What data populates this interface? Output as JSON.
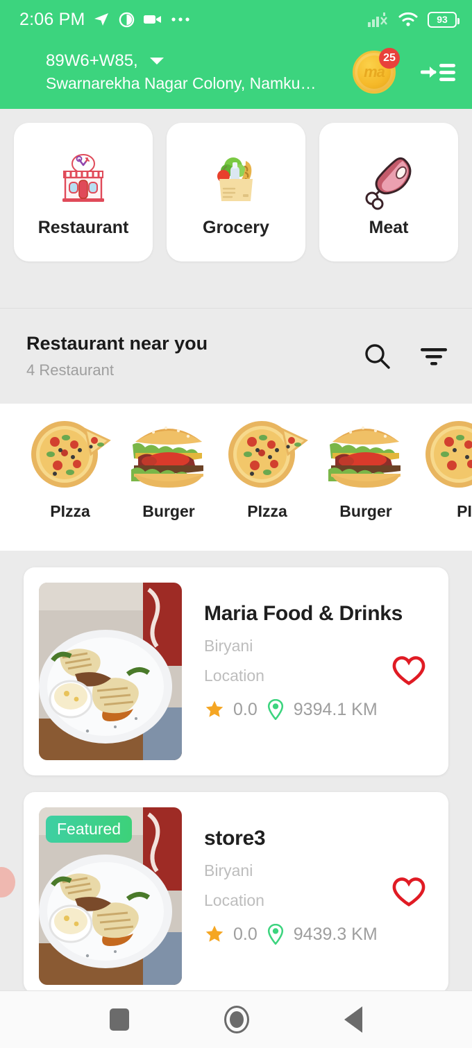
{
  "status_bar": {
    "time": "2:06 PM",
    "battery_percent": "93",
    "icons": [
      "send-icon",
      "contrast-circle-icon",
      "video-camera-icon",
      "more-dots-icon",
      "cellular-signal-icon",
      "wifi-icon",
      "battery-icon"
    ]
  },
  "header": {
    "address_code": "89W6+W85,",
    "address_detail": "Swarnarekha Nagar Colony, Namkum, ...",
    "dropdown_icon": "chevron-down-icon",
    "coin_label": "ma",
    "coin_badge_count": "25",
    "menu_icon": "drawer-menu-icon",
    "background_color": "#3cd47e"
  },
  "categories": [
    {
      "label": "Restaurant",
      "icon": "restaurant-building-icon"
    },
    {
      "label": "Grocery",
      "icon": "grocery-bag-icon"
    },
    {
      "label": "Meat",
      "icon": "meat-ham-icon"
    }
  ],
  "section": {
    "title": "Restaurant near you",
    "subtitle": "4 Restaurant",
    "search_icon": "search-icon",
    "filter_icon": "filter-icon"
  },
  "food_categories": [
    {
      "label": "PIzza",
      "icon": "pizza-icon"
    },
    {
      "label": "Burger",
      "icon": "burger-icon"
    },
    {
      "label": "PIzza",
      "icon": "pizza-icon"
    },
    {
      "label": "Burger",
      "icon": "burger-icon"
    },
    {
      "label": "PI",
      "icon": "pizza-icon"
    }
  ],
  "restaurants": [
    {
      "name": "Maria Food & Drinks",
      "cuisine": "Biryani",
      "location": "Location",
      "rating": "0.0",
      "distance": "9394.1 KM",
      "featured": false,
      "featured_label": "",
      "favorite_icon": "heart-outline-icon",
      "star_icon": "star-icon",
      "pin_icon": "location-pin-icon"
    },
    {
      "name": "store3",
      "cuisine": "Biryani",
      "location": "Location",
      "rating": "0.0",
      "distance": "9439.3 KM",
      "featured": true,
      "featured_label": "Featured",
      "favorite_icon": "heart-outline-icon",
      "star_icon": "star-icon",
      "pin_icon": "location-pin-icon"
    }
  ],
  "nav_bar": {
    "recents": "recents-square-icon",
    "home": "home-circle-icon",
    "back": "back-triangle-icon"
  },
  "colors": {
    "brand_green": "#3cd47e",
    "page_bg": "#ebebeb",
    "card_bg": "#ffffff",
    "heart_red": "#e01b24",
    "star_amber": "#f5a623",
    "pin_green": "#3cd47e",
    "badge_red": "#e8413b",
    "muted_text": "#bdbdbd"
  }
}
